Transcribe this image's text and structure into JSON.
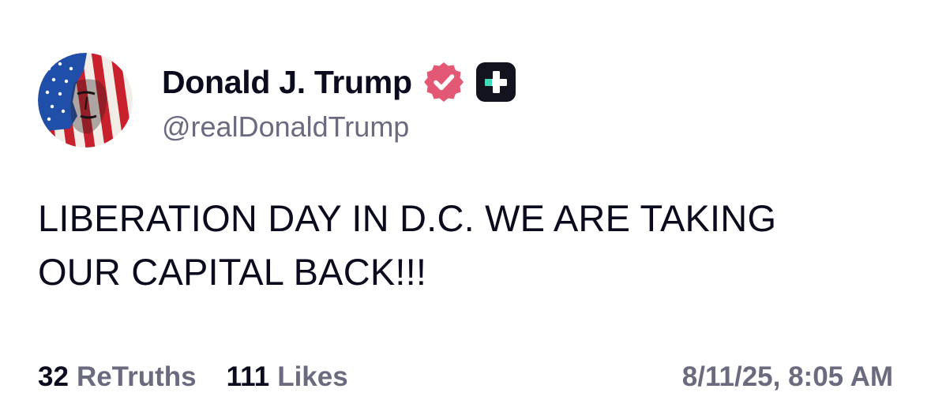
{
  "author": {
    "display_name": "Donald J. Trump",
    "handle": "@realDonaldTrump",
    "avatar_icon": "flag-portrait-avatar",
    "verified_icon": "verified-badge-icon",
    "verified_color": "#e35874",
    "plus_icon": "truth-plus-icon",
    "plus_color": "#13131f",
    "plus_accent": "#3ddbb8"
  },
  "post": {
    "lines": [
      "LIBERATION DAY IN D.C. WE ARE TAKING",
      "OUR CAPITAL BACK!!!"
    ]
  },
  "stats": {
    "retruths_count": "32",
    "retruths_label": "ReTruths",
    "likes_count": "111",
    "likes_label": "Likes"
  },
  "timestamp": "8/11/25, 8:05 AM"
}
